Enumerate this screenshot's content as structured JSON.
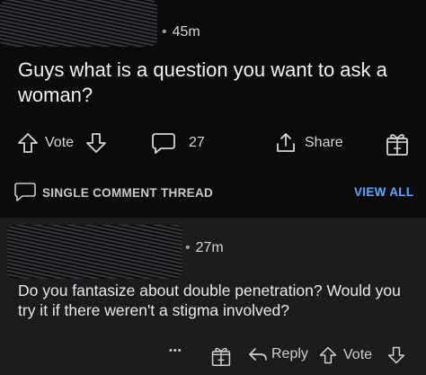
{
  "post": {
    "time": "45m",
    "title": "Guys what is a question you want to ask a woman?",
    "vote_label": "Vote",
    "comment_count": "27",
    "share_label": "Share"
  },
  "thread": {
    "single_comment_label": "SINGLE COMMENT THREAD",
    "view_all_label": "VIEW ALL"
  },
  "comment": {
    "time": "27m",
    "text": "Do you fantasize about double penetration? Would you try it if there weren't a stigma involved?",
    "more_label": "•••",
    "reply_label": "Reply",
    "vote_label": "Vote"
  },
  "colors": {
    "accent_link": "#5ea8ff",
    "background": "#0b0b0d",
    "comment_bg": "#1c1c1e"
  }
}
